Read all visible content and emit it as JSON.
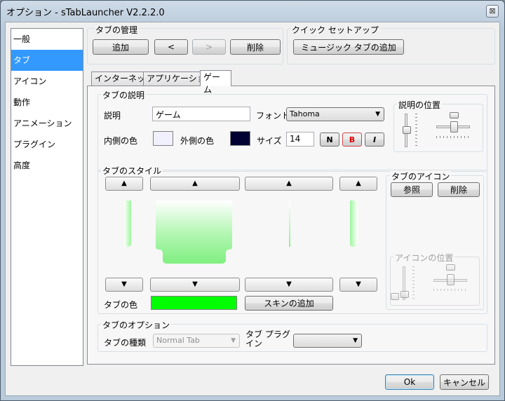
{
  "window": {
    "title": "オプション - sTabLauncher V2.2.2.0",
    "close_glyph": "⊠"
  },
  "sidebar": {
    "items": [
      {
        "label": "一般"
      },
      {
        "label": "タブ",
        "selected": true
      },
      {
        "label": "アイコン"
      },
      {
        "label": "動作"
      },
      {
        "label": "アニメーション"
      },
      {
        "label": "プラグイン"
      },
      {
        "label": "高度"
      }
    ]
  },
  "tab_manage": {
    "title": "タブの管理",
    "add": "追加",
    "prev": "<",
    "next": ">",
    "delete": "削除"
  },
  "quick_setup": {
    "title": "クイック セットアップ",
    "music_button": "ミュージック タブの追加"
  },
  "tabs": [
    {
      "label": "インターネット"
    },
    {
      "label": "アプリケーション"
    },
    {
      "label": "ゲーム",
      "active": true
    }
  ],
  "desc": {
    "title": "タブの説明",
    "desc_label": "説明",
    "desc_value": "ゲーム",
    "font_label": "フォント",
    "font_value": "Tahoma",
    "inner_color_label": "内側の色",
    "outer_color_label": "外側の色",
    "size_label": "サイズ",
    "size_value": "14",
    "bold_n": "N",
    "bold_b": "B",
    "italic_i": "I",
    "inner_color": "#f0f0ff",
    "outer_color": "#000033",
    "position_title": "説明の位置"
  },
  "style": {
    "title": "タブのスタイル",
    "up": "▲",
    "down": "▼",
    "color_label": "タブの色",
    "tab_color": "#00ff00",
    "skin_button": "スキンの追加"
  },
  "icon": {
    "title": "タブのアイコン",
    "browse": "参照",
    "delete": "削除",
    "position_title": "アイコンの位置"
  },
  "options": {
    "title": "タブのオプション",
    "type_label": "タブの種類",
    "type_value": "Normal Tab",
    "plugin_label": "タブ プラグイン",
    "plugin_value": ""
  },
  "footer": {
    "ok": "Ok",
    "cancel": "キャンセル"
  },
  "colors": {
    "accent": "#3399ff"
  }
}
